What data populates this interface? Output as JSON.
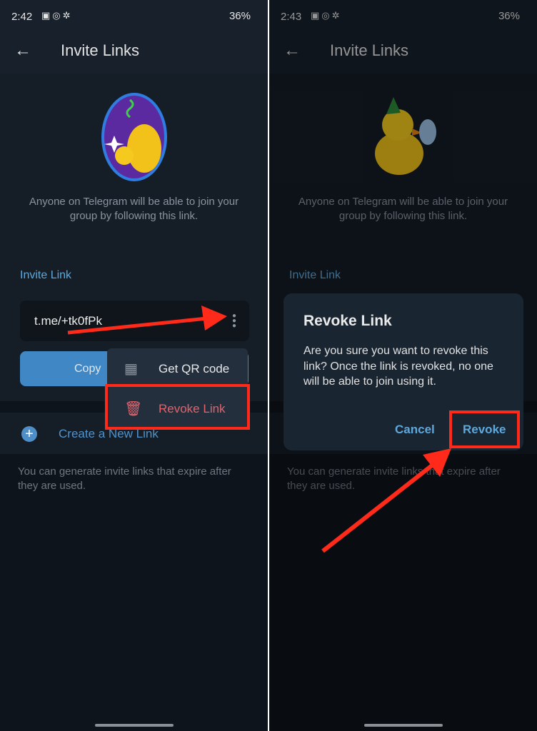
{
  "left": {
    "status": {
      "time": "2:42",
      "battery": "36%"
    },
    "header": {
      "title": "Invite Links"
    },
    "description": "Anyone on Telegram will be able to join your group by following this link.",
    "invite_label": "Invite Link",
    "link": "t.me/+tk0fPk",
    "copy_label": "Copy",
    "menu": [
      {
        "label": "Get QR code",
        "icon": "qr-code-icon"
      },
      {
        "label": "Revoke Link",
        "icon": "trash-icon",
        "color": "#e5626a"
      }
    ],
    "create_label": "Create a New Link",
    "footer": "You can generate invite links that expire after they are used."
  },
  "right": {
    "status": {
      "time": "2:43",
      "battery": "36%"
    },
    "header": {
      "title": "Invite Links"
    },
    "description": "Anyone on Telegram will be able to join your group by following this link.",
    "invite_label": "Invite Link",
    "footer": "You can generate invite links that expire after they are used.",
    "dialog": {
      "title": "Revoke Link",
      "text": "Are you sure you want to revoke this link? Once the link is revoked, no one will be able to join using it.",
      "cancel": "Cancel",
      "confirm": "Revoke"
    }
  },
  "colors": {
    "accent": "#5ea8dc",
    "button": "#3f88c5",
    "danger": "#e5626a",
    "annotation": "#ff2a1a"
  }
}
